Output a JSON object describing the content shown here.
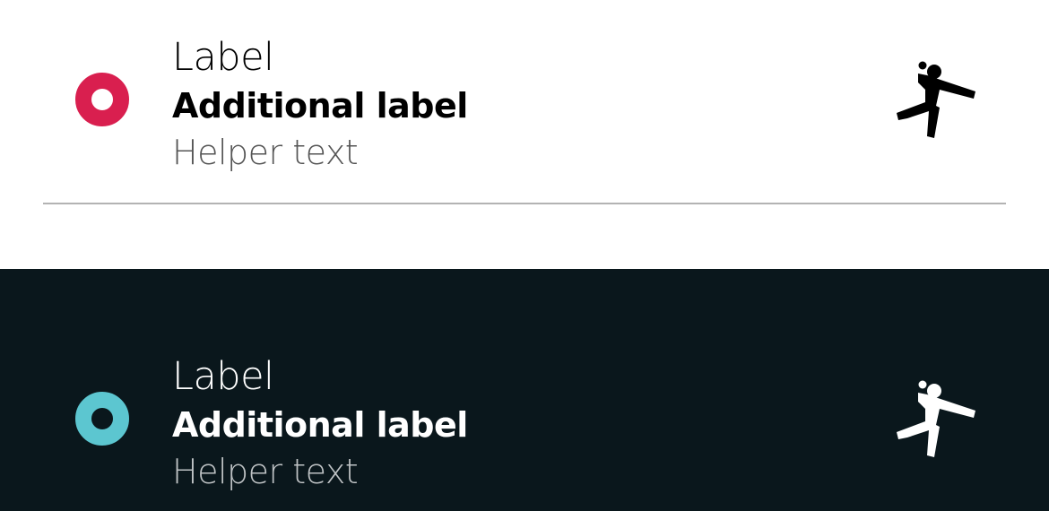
{
  "light_item": {
    "label": "Label",
    "additional_label": "Additional label",
    "helper_text": "Helper text",
    "radio_color": "#d91f4f",
    "icon": "handball-icon",
    "icon_color": "#000000",
    "selected": true
  },
  "dark_item": {
    "label": "Label",
    "additional_label": "Additional label",
    "helper_text": "Helper text",
    "radio_color": "#5cc6d0",
    "icon": "handball-icon",
    "icon_color": "#ffffff",
    "selected": true
  },
  "colors": {
    "light_background": "#ffffff",
    "dark_background": "#0a171c",
    "divider": "#b3b3b3"
  }
}
